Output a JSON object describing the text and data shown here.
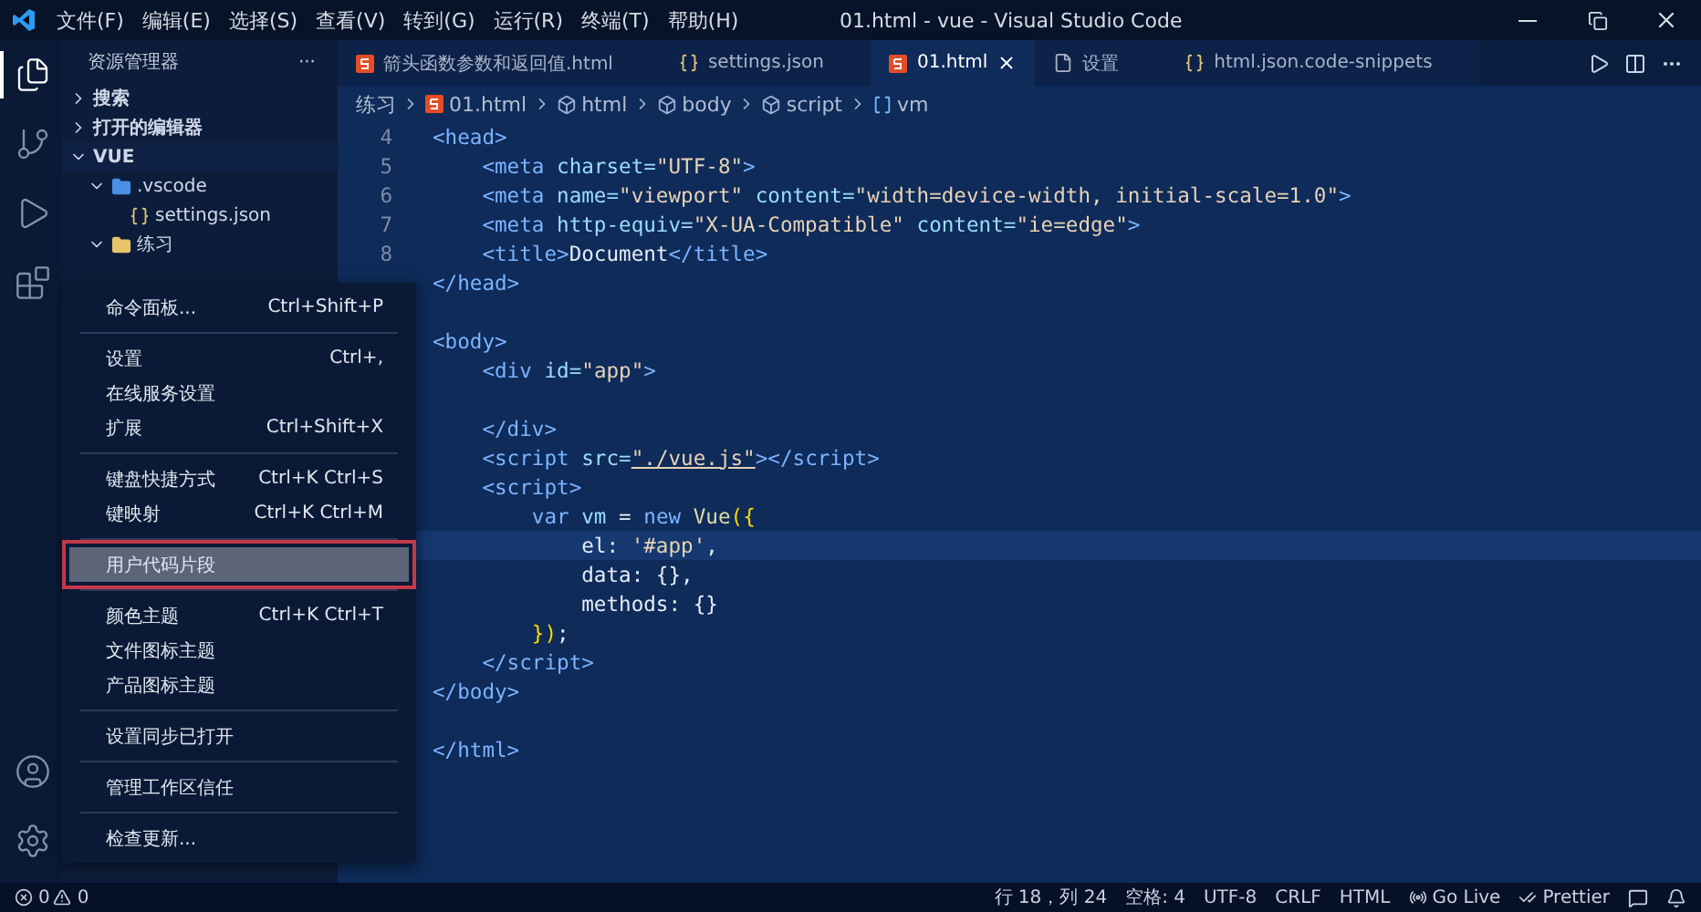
{
  "window": {
    "title": "01.html - vue - Visual Studio Code"
  },
  "menu_bar": [
    "文件(F)",
    "编辑(E)",
    "选择(S)",
    "查看(V)",
    "转到(G)",
    "运行(R)",
    "终端(T)",
    "帮助(H)"
  ],
  "activity_bar": [
    {
      "kind": "explorer",
      "selected": true
    },
    {
      "kind": "source-control",
      "selected": false
    },
    {
      "kind": "run",
      "selected": false
    },
    {
      "kind": "extensions",
      "selected": false
    }
  ],
  "activity_bottom": [
    {
      "kind": "account"
    },
    {
      "kind": "manage"
    }
  ],
  "sidebar": {
    "title": "资源管理器",
    "more": "···",
    "sections": [
      {
        "label": "搜索",
        "expanded": false
      },
      {
        "label": "打开的编辑器",
        "expanded": false
      },
      {
        "label": "VUE",
        "expanded": true
      }
    ],
    "tree": [
      {
        "label": ".vscode",
        "kind": "vscode-folder",
        "expanded": true,
        "children": [
          {
            "label": "settings.json",
            "kind": "json"
          }
        ]
      },
      {
        "label": "练习",
        "kind": "folder",
        "expanded": true
      }
    ]
  },
  "tabs": [
    {
      "label": "箭头函数参数和返回值.html",
      "kind": "html",
      "selected": false
    },
    {
      "label": "settings.json",
      "kind": "json",
      "selected": false
    },
    {
      "label": "01.html",
      "kind": "html",
      "selected": true
    },
    {
      "label": "设置",
      "kind": "file",
      "selected": false
    },
    {
      "label": "html.json.code-snippets",
      "kind": "json",
      "selected": false
    }
  ],
  "breadcrumb": [
    {
      "label": "练习",
      "kind": "folder"
    },
    {
      "label": "01.html",
      "kind": "html"
    },
    {
      "label": "html",
      "kind": "element"
    },
    {
      "label": "body",
      "kind": "element"
    },
    {
      "label": "script",
      "kind": "element"
    },
    {
      "label": "vm",
      "kind": "variable"
    }
  ],
  "editor": {
    "lines": [
      {
        "number": "4",
        "current": false,
        "tokens": [
          {
            "kind": "tag",
            "text": "<head>"
          }
        ]
      },
      {
        "number": "5",
        "current": false,
        "tokens": [
          {
            "kind": "tag",
            "text": "    <meta"
          },
          {
            "kind": "attr",
            "text": " charset="
          },
          {
            "kind": "str",
            "text": "\"UTF-8\""
          },
          {
            "kind": "tag",
            "text": ">"
          }
        ]
      },
      {
        "number": "6",
        "current": false,
        "tokens": [
          {
            "kind": "tag",
            "text": "    <meta"
          },
          {
            "kind": "attr",
            "text": " name="
          },
          {
            "kind": "str",
            "text": "\"viewport\""
          },
          {
            "kind": "attr",
            "text": " content="
          },
          {
            "kind": "str",
            "text": "\"width=device-width, initial-scale=1.0\""
          },
          {
            "kind": "tag",
            "text": ">"
          }
        ]
      },
      {
        "number": "7",
        "current": false,
        "tokens": [
          {
            "kind": "tag",
            "text": "    <meta"
          },
          {
            "kind": "attr",
            "text": " http-equiv="
          },
          {
            "kind": "str",
            "text": "\"X-UA-Compatible\""
          },
          {
            "kind": "attr",
            "text": " content="
          },
          {
            "kind": "str",
            "text": "\"ie=edge\""
          },
          {
            "kind": "tag",
            "text": ">"
          }
        ]
      },
      {
        "number": "8",
        "current": false,
        "tokens": [
          {
            "kind": "tag",
            "text": "    <title>"
          },
          {
            "kind": "text",
            "text": "Document"
          },
          {
            "kind": "tag",
            "text": "</title>"
          }
        ]
      },
      {
        "current": false,
        "tokens": [
          {
            "kind": "tag",
            "text": "</head>"
          }
        ]
      },
      {
        "current": false
      },
      {
        "current": false,
        "tokens": [
          {
            "kind": "tag",
            "text": "<body>"
          }
        ]
      },
      {
        "current": false,
        "tokens": [
          {
            "kind": "tag",
            "text": "    <div"
          },
          {
            "kind": "attr",
            "text": " id="
          },
          {
            "kind": "str",
            "text": "\"app\""
          },
          {
            "kind": "tag",
            "text": ">"
          }
        ]
      },
      {
        "current": false
      },
      {
        "current": false,
        "tokens": [
          {
            "kind": "tag",
            "text": "    </div>"
          }
        ]
      },
      {
        "current": false,
        "tokens": [
          {
            "kind": "tag",
            "text": "    <script"
          },
          {
            "kind": "attr",
            "text": " src="
          },
          {
            "kind": "link",
            "text": "\"./vue.js\""
          },
          {
            "kind": "tag",
            "text": "></script>"
          }
        ]
      },
      {
        "current": false,
        "tokens": [
          {
            "kind": "tag",
            "text": "    <script>"
          }
        ]
      },
      {
        "current": false,
        "tokens": [
          {
            "kind": "kw",
            "text": "        var"
          },
          {
            "kind": "var",
            "text": " vm"
          },
          {
            "kind": "text",
            "text": " = "
          },
          {
            "kind": "kw",
            "text": "new"
          },
          {
            "kind": "fn",
            "text": " Vue"
          },
          {
            "kind": "bracket",
            "text": "({"
          }
        ]
      },
      {
        "current": true,
        "tokens": [
          {
            "kind": "text",
            "text": "            el: "
          },
          {
            "kind": "str",
            "text": "'#app'"
          },
          {
            "kind": "text",
            "text": ","
          }
        ]
      },
      {
        "current": false,
        "tokens": [
          {
            "kind": "text",
            "text": "            data: {},"
          }
        ]
      },
      {
        "current": false,
        "tokens": [
          {
            "kind": "text",
            "text": "            methods: {}"
          }
        ]
      },
      {
        "current": false,
        "tokens": [
          {
            "kind": "bracket",
            "text": "        })"
          },
          {
            "kind": "text",
            "text": ";"
          }
        ]
      },
      {
        "current": false,
        "tokens": [
          {
            "kind": "tag",
            "text": "    </script>"
          }
        ]
      },
      {
        "current": false,
        "tokens": [
          {
            "kind": "tag",
            "text": "</body>"
          }
        ]
      },
      {
        "current": false
      },
      {
        "current": false,
        "tokens": [
          {
            "kind": "tag",
            "text": "</html>"
          }
        ]
      }
    ]
  },
  "context_menu": [
    {
      "kind": "item",
      "label": "命令面板...",
      "shortcut": "Ctrl+Shift+P",
      "selected": false
    },
    {
      "kind": "separator"
    },
    {
      "kind": "item",
      "label": "设置",
      "shortcut": "Ctrl+,",
      "selected": false
    },
    {
      "kind": "item",
      "label": "在线服务设置",
      "selected": false
    },
    {
      "kind": "item",
      "label": "扩展",
      "shortcut": "Ctrl+Shift+X",
      "selected": false
    },
    {
      "kind": "separator"
    },
    {
      "kind": "item",
      "label": "键盘快捷方式",
      "shortcut": "Ctrl+K Ctrl+S",
      "selected": false
    },
    {
      "kind": "item",
      "label": "键映射",
      "shortcut": "Ctrl+K Ctrl+M",
      "selected": false
    },
    {
      "kind": "separator"
    },
    {
      "kind": "item",
      "label": "用户代码片段",
      "selected": true
    },
    {
      "kind": "separator"
    },
    {
      "kind": "item",
      "label": "颜色主题",
      "shortcut": "Ctrl+K Ctrl+T",
      "selected": false
    },
    {
      "kind": "item",
      "label": "文件图标主题",
      "selected": false
    },
    {
      "kind": "item",
      "label": "产品图标主题",
      "selected": false
    },
    {
      "kind": "separator"
    },
    {
      "kind": "item",
      "label": "设置同步已打开",
      "selected": false
    },
    {
      "kind": "separator"
    },
    {
      "kind": "item",
      "label": "管理工作区信任",
      "selected": false
    },
    {
      "kind": "separator"
    },
    {
      "kind": "item",
      "label": "检查更新...",
      "selected": false
    }
  ],
  "status_bar": {
    "errors": "0",
    "warnings": "0",
    "items": [
      {
        "kind": "text",
        "label": "行 18，列 24"
      },
      {
        "kind": "text",
        "label": "空格: 4"
      },
      {
        "kind": "text",
        "label": "UTF-8"
      },
      {
        "kind": "text",
        "label": "CRLF"
      },
      {
        "kind": "text",
        "label": "HTML"
      },
      {
        "kind": "golive",
        "label": "Go Live"
      },
      {
        "kind": "prettier",
        "label": "Prettier"
      },
      {
        "kind": "feedback"
      },
      {
        "kind": "bell"
      }
    ]
  }
}
